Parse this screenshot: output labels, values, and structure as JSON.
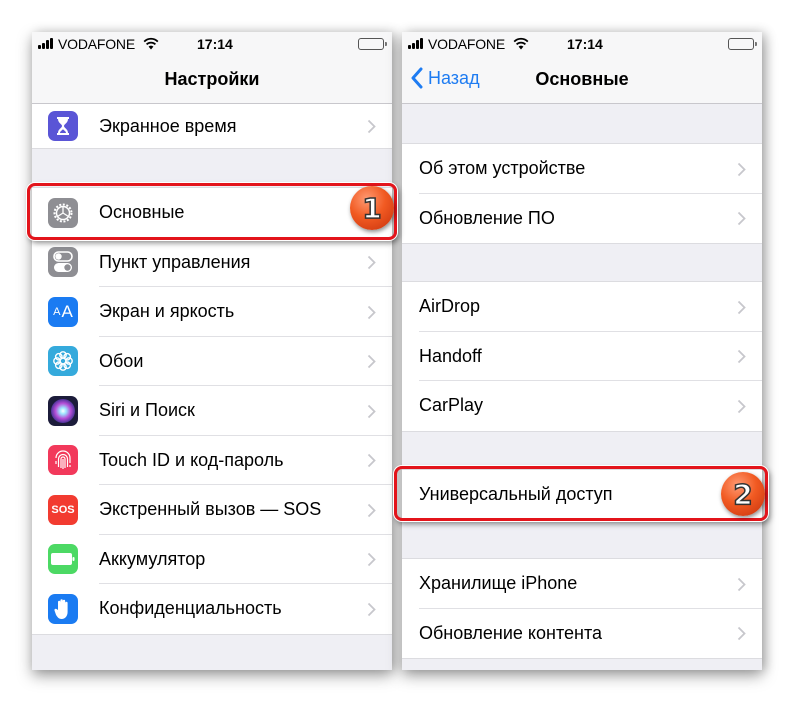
{
  "left_screen": {
    "status_bar": {
      "carrier": "VODAFONE",
      "time": "17:14"
    },
    "nav_title": "Настройки",
    "top_item": {
      "label": "Экранное время",
      "icon": "hourglass-icon",
      "icon_color": "#5a55d6"
    },
    "items": [
      {
        "label": "Основные",
        "icon": "gear-icon",
        "icon_color": "#8e8e93"
      },
      {
        "label": "Пункт управления",
        "icon": "toggles-icon",
        "icon_color": "#8e8e93"
      },
      {
        "label": "Экран и яркость",
        "icon": "text-size-icon",
        "icon_color": "#1a7bf2"
      },
      {
        "label": "Обои",
        "icon": "flower-icon",
        "icon_color": "#35aadc"
      },
      {
        "label": "Siri и Поиск",
        "icon": "siri-icon",
        "icon_color": "#1c1c3a"
      },
      {
        "label": "Touch ID и код-пароль",
        "icon": "fingerprint-icon",
        "icon_color": "#f2395b"
      },
      {
        "label": "Экстренный вызов — SOS",
        "icon": "sos-icon",
        "icon_color": "#f23b30",
        "icon_text": "SOS"
      },
      {
        "label": "Аккумулятор",
        "icon": "battery-icon",
        "icon_color": "#4cd964"
      },
      {
        "label": "Конфиденциальность",
        "icon": "hand-icon",
        "icon_color": "#1a7bf2"
      }
    ],
    "step_badge": "1"
  },
  "right_screen": {
    "status_bar": {
      "carrier": "VODAFONE",
      "time": "17:14"
    },
    "back_label": "Назад",
    "nav_title": "Основные",
    "groups": [
      [
        "Об этом устройстве",
        "Обновление ПО"
      ],
      [
        "AirDrop",
        "Handoff",
        "CarPlay"
      ],
      [
        "Универсальный доступ"
      ],
      [
        "Хранилище iPhone",
        "Обновление контента"
      ]
    ],
    "step_badge": "2"
  },
  "colors": {
    "accent_blue": "#1e7cf2",
    "highlight_red": "#e3141b",
    "badge_orange": "#f15a22"
  }
}
